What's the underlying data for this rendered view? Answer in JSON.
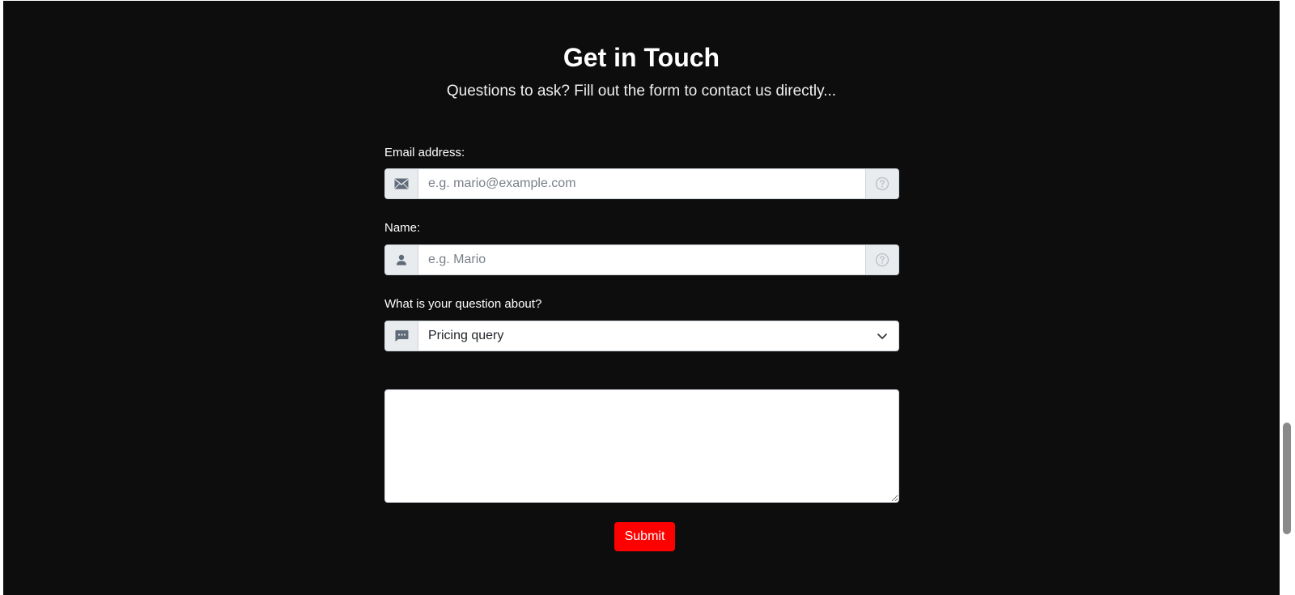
{
  "header": {
    "title": "Get in Touch",
    "subtitle": "Questions to ask? Fill out the form to contact us directly..."
  },
  "form": {
    "email": {
      "label": "Email address:",
      "placeholder": "e.g. mario@example.com",
      "value": "",
      "icon": "envelope-icon",
      "help_icon": "question-circle-icon"
    },
    "name": {
      "label": "Name:",
      "placeholder": "e.g. Mario",
      "value": "",
      "icon": "person-icon",
      "help_icon": "question-circle-icon"
    },
    "topic": {
      "label": "What is your question about?",
      "selected": "Pricing query",
      "icon": "chat-dots-icon"
    },
    "message": {
      "value": ""
    },
    "submit_label": "Submit"
  },
  "colors": {
    "background": "#0d0d0d",
    "submit": "#ff0000",
    "addon": "#e9ecef",
    "icon": "#5f6b78"
  }
}
